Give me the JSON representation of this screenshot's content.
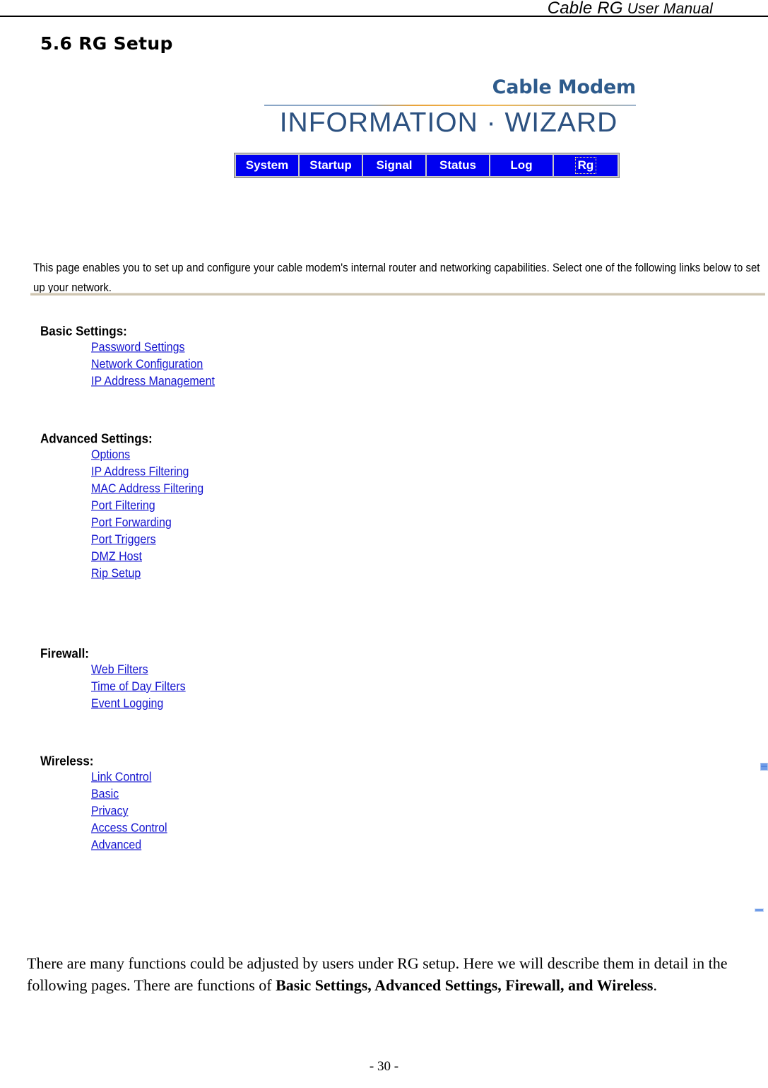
{
  "document": {
    "running_header_italic_lead": "Cable RG",
    "running_header_rest": " User Manual",
    "section_title": "5.6 RG Setup",
    "page_number": "- 30 -",
    "closing_paragraph_part1": "There are many functions could be adjusted by users under RG setup. Here we will describe them in detail in the following pages. There are functions of ",
    "closing_paragraph_bold": "Basic Settings, Advanced Settings, Firewall, and Wireless",
    "closing_paragraph_part2": "."
  },
  "screenshot": {
    "logo": {
      "top_line": "Cable Modem",
      "main_line": "INFORMATION · WIZARD"
    },
    "tabs": [
      {
        "label": "System",
        "focused": false
      },
      {
        "label": "Startup",
        "focused": false
      },
      {
        "label": "Signal",
        "focused": false
      },
      {
        "label": "Status",
        "focused": false
      },
      {
        "label": "Log",
        "focused": false
      },
      {
        "label": "Rg",
        "focused": true
      }
    ],
    "description": "This page enables you to set up and configure your cable modem's internal router and networking capabilities.  Select one of the following links below to set up your network.",
    "groups": [
      {
        "heading": "Basic Settings:",
        "links": [
          "Password Settings",
          "Network Configuration",
          "IP Address Management"
        ]
      },
      {
        "heading": "Advanced Settings:",
        "links": [
          "Options",
          "IP Address Filtering",
          "MAC Address Filtering",
          "Port Filtering",
          "Port Forwarding",
          "Port Triggers",
          "DMZ Host",
          "Rip Setup"
        ]
      },
      {
        "heading": "Firewall:",
        "links": [
          "Web Filters",
          "Time of Day Filters",
          "Event Logging"
        ]
      },
      {
        "heading": "Wireless:",
        "links": [
          "Link Control",
          "Basic",
          "Privacy",
          "Access Control",
          "Advanced"
        ]
      }
    ]
  },
  "colors": {
    "tab_blue": "#0000f0",
    "link_blue": "#1414cf",
    "logo_blue": "#2c5180",
    "rule_tan": "#cfc6b2"
  }
}
